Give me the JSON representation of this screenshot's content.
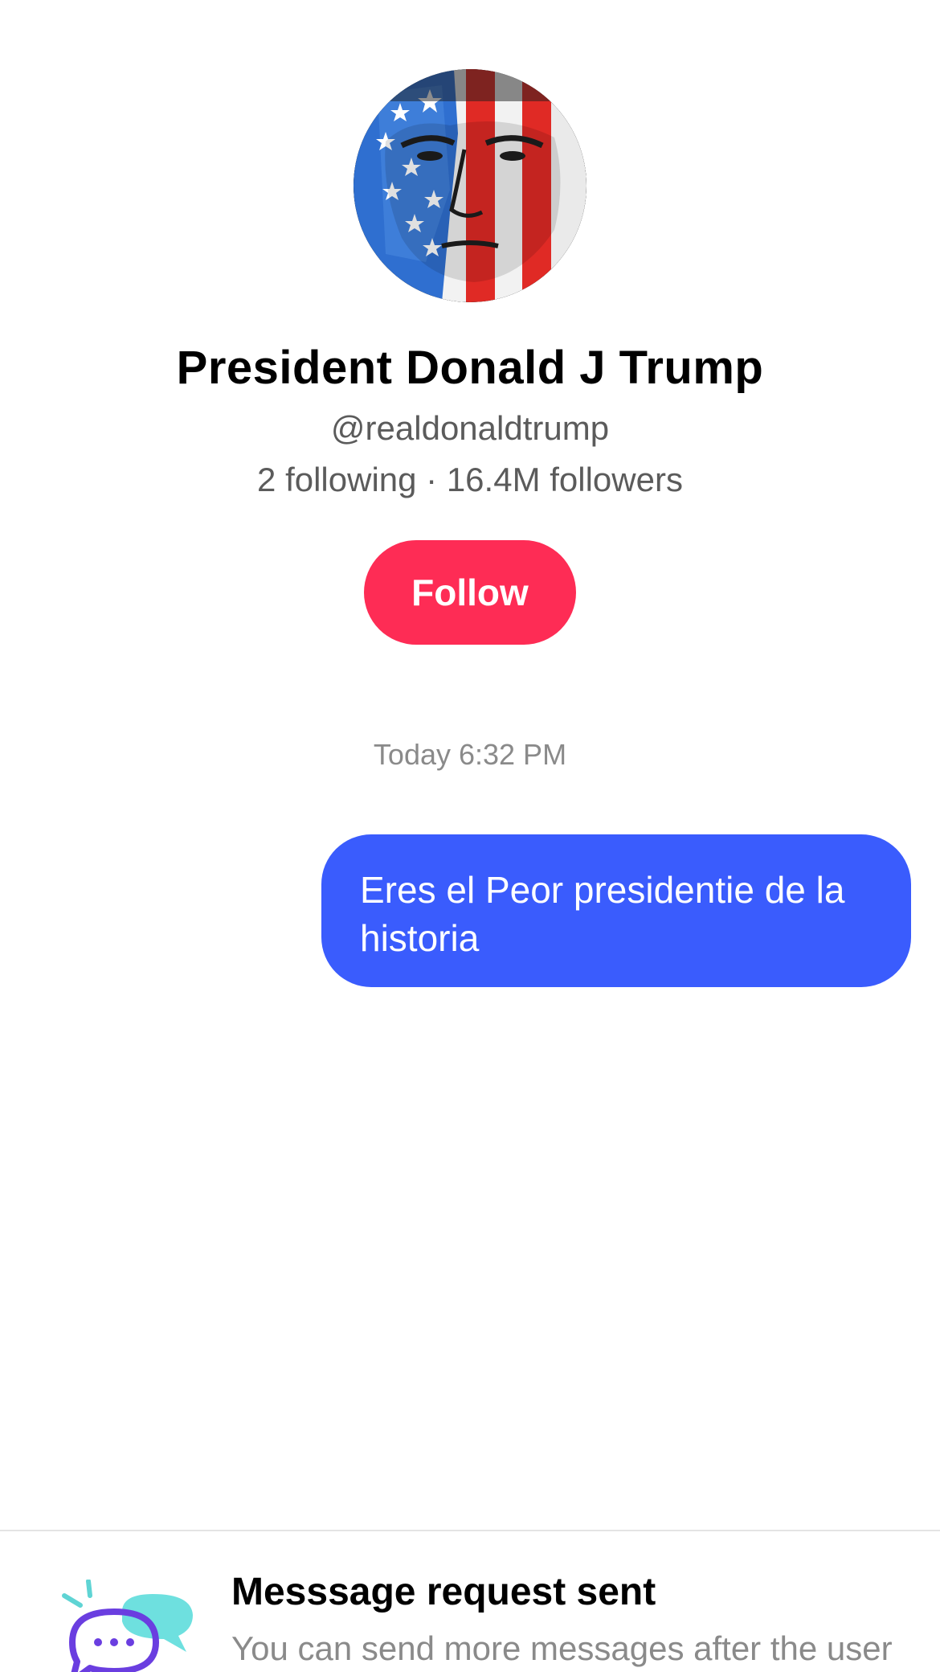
{
  "profile": {
    "name": "President Donald J Trump",
    "handle": "@realdonaldtrump",
    "stats": "2 following · 16.4M followers",
    "follow_label": "Follow"
  },
  "conversation": {
    "timestamp": "Today 6:32 PM",
    "messages": [
      {
        "from": "me",
        "text": "Eres el Peor presidentie de la historia"
      }
    ]
  },
  "request_panel": {
    "title": "Messsage request sent",
    "subtitle": "You can send more messages after the user replies."
  },
  "colors": {
    "follow_button": "#fe2c55",
    "bubble": "#3a5cfd",
    "secondary_text": "#5b5b5b",
    "muted_text": "#8a8a8a"
  },
  "icons": {
    "avatar": "flag-face-painting",
    "request": "chat-bubbles-icon"
  }
}
